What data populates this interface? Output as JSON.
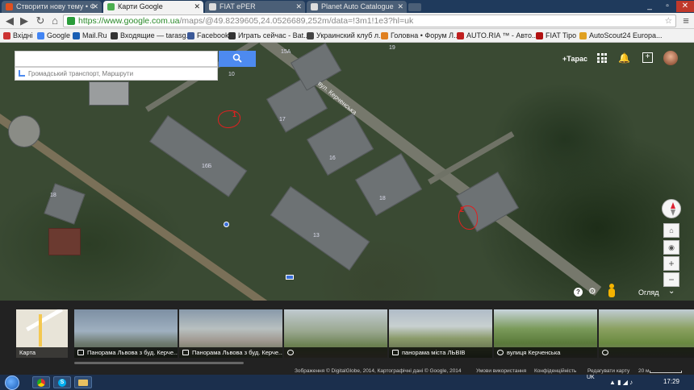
{
  "browser": {
    "tabs": [
      {
        "title": "Створити нову тему • Ф",
        "color": "#e05020"
      },
      {
        "title": "Карти Google",
        "color": "#4caf50"
      },
      {
        "title": "FIAT ePER",
        "color": "#dddddd"
      },
      {
        "title": "Planet Auto Catalogue",
        "color": "#dddddd"
      }
    ],
    "url_host": "https://www.google.com.ua",
    "url_path": "/maps/@49.8239605,24.0526689,252m/data=!3m1!1e3?hl=uk",
    "bookmarks": [
      {
        "label": "Вхідні",
        "color": "#c33"
      },
      {
        "label": "Google",
        "color": "#4285f4"
      },
      {
        "label": "Mail.Ru",
        "color": "#1a5fb4"
      },
      {
        "label": "Входящие — tarasg...",
        "color": "#333"
      },
      {
        "label": "Facebook",
        "color": "#3b5998"
      },
      {
        "label": "Играть сейчас - Bat...",
        "color": "#333"
      },
      {
        "label": "Украинский клуб л...",
        "color": "#444"
      },
      {
        "label": "Головна • Форум Л...",
        "color": "#e08020"
      },
      {
        "label": "AUTO.RIA ™ - Авто...",
        "color": "#c02020"
      },
      {
        "label": "FIAT Tipo",
        "color": "#b01010"
      },
      {
        "label": "AutoScout24 Europa...",
        "color": "#e0a020"
      }
    ]
  },
  "maps": {
    "search_placeholder": "",
    "transit_hint": "Громадський транспорт, Маршрути",
    "user_name": "+Тарас",
    "view_mode": "Огляд",
    "street_label": "вул. Керченська",
    "building_numbers": [
      "15А",
      "19",
      "17",
      "16",
      "18",
      "10",
      "16Б",
      "18",
      "13"
    ],
    "marker_labels": [
      "1",
      "2"
    ],
    "thumbnails": [
      {
        "caption": "Карта"
      },
      {
        "caption": "Панорама Львова з буд. Керче..."
      },
      {
        "caption": "Панорама Львова з буд. Керче..."
      },
      {
        "caption": ""
      },
      {
        "caption": "панорама міста ЛЬВІВ"
      },
      {
        "caption": "вулиця Керченська"
      },
      {
        "caption": ""
      }
    ],
    "footer": {
      "imagery": "Зображення © DigitalGlobe, 2014, Картографічні дані © Google, 2014",
      "terms": "Умови використання",
      "privacy": "Конфіденційність",
      "edit": "Редагувати карту",
      "scale": "20 м"
    }
  },
  "taskbar": {
    "lang": "UK",
    "time": "17:29"
  }
}
